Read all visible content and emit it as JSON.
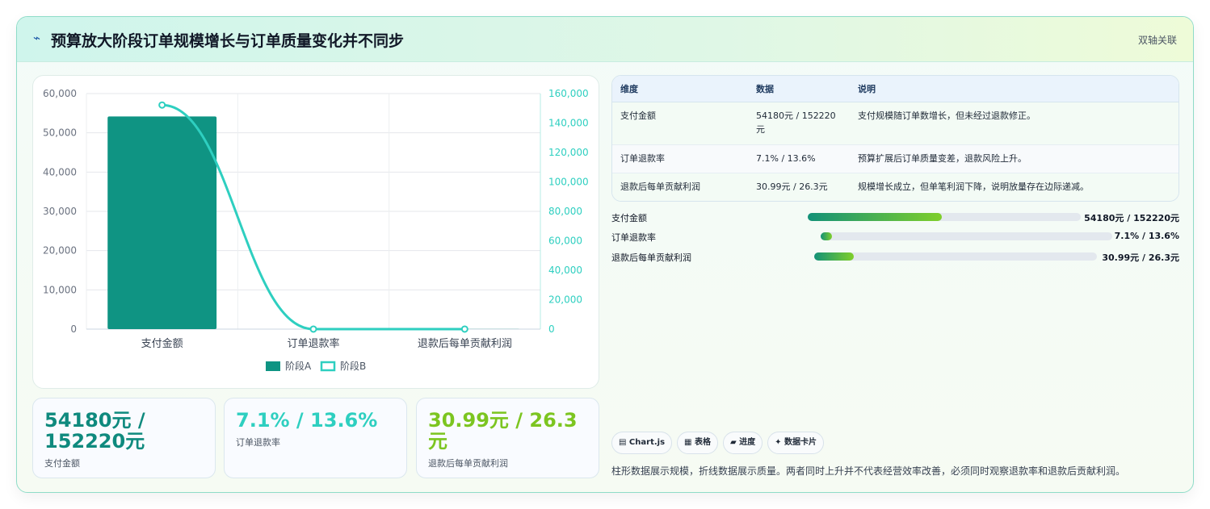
{
  "header": {
    "icon": "lightning-icon",
    "title": "预算放大阶段订单规模增长与订单质量变化并不同步",
    "badge": "双轴关联"
  },
  "chart_data": {
    "type": "bar",
    "categories": [
      "支付金额",
      "订单退款率",
      "退款后每单贡献利润"
    ],
    "series": [
      {
        "name": "阶段A",
        "type": "bar",
        "axis": "left",
        "values": [
          54180,
          7.1,
          30.99
        ],
        "color": "#0f9483"
      },
      {
        "name": "阶段B",
        "type": "line",
        "axis": "right",
        "values": [
          152220,
          13.6,
          26.3
        ],
        "color": "#2ecfc0"
      }
    ],
    "y_left": {
      "min": 0,
      "max": 60000,
      "ticks": [
        "0",
        "10,000",
        "20,000",
        "30,000",
        "40,000",
        "50,000",
        "60,000"
      ]
    },
    "y_right": {
      "min": 0,
      "max": 160000,
      "ticks": [
        "0",
        "20,000",
        "40,000",
        "60,000",
        "80,000",
        "100,000",
        "120,000",
        "140,000",
        "160,000"
      ]
    },
    "grid": true,
    "legend": "bottom"
  },
  "stats": [
    {
      "value": "54180元 / 152220元",
      "label": "支付金额",
      "color": "#0f8a7e"
    },
    {
      "value": "7.1% / 13.6%",
      "label": "订单退款率",
      "color": "#2ecfc0"
    },
    {
      "value": "30.99元 / 26.3元",
      "label": "退款后每单贡献利润",
      "color": "#7cc520"
    }
  ],
  "table": {
    "headers": [
      "维度",
      "数据",
      "说明"
    ],
    "rows": [
      [
        "支付金额",
        "54180元 / 152220元",
        "支付规模随订单数增长，但未经过退款修正。"
      ],
      [
        "订单退款率",
        "7.1% / 13.6%",
        "预算扩展后订单质量变差，退款风险上升。"
      ],
      [
        "退款后每单贡献利润",
        "30.99元 / 26.3元",
        "规模增长成立，但单笔利润下降，说明放量存在边际递减。"
      ]
    ]
  },
  "progress": [
    {
      "label": "支付金额",
      "value": "54180元 / 152220元",
      "fraction": 0.49
    },
    {
      "label": "订单退款率",
      "value": "7.1% / 13.6%",
      "fraction": 0.04
    },
    {
      "label": "退款后每单贡献利润",
      "value": "30.99元 / 26.3元",
      "fraction": 0.14
    }
  ],
  "chips": [
    "▤ Chart.js",
    "▦ 表格",
    "▰ 进度",
    "✦ 数据卡片"
  ],
  "note": "柱形数据展示规模，折线数据展示质量。两者同时上升并不代表经营效率改善，必须同时观察退款率和退款后贡献利润。"
}
